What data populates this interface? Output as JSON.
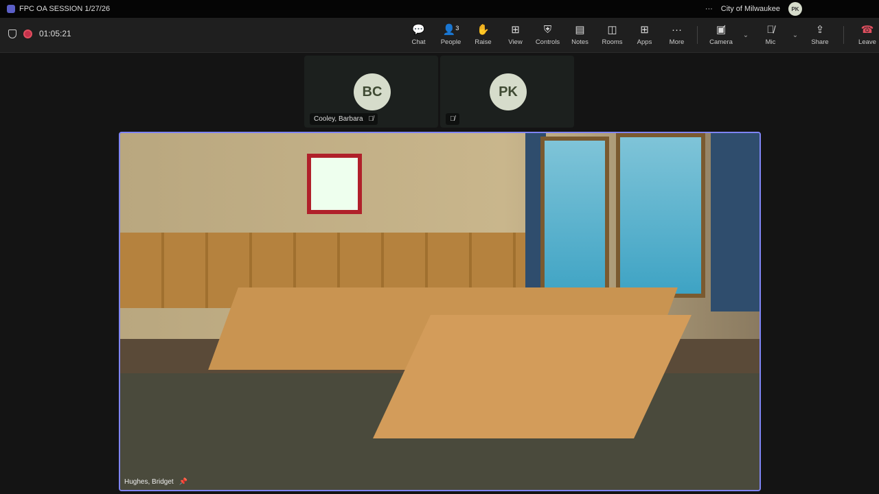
{
  "window": {
    "title": "FPC OA SESSION 1/27/26",
    "org": "City of Milwaukee",
    "user_initials": "PK",
    "more": "···"
  },
  "meeting": {
    "elapsed": "01:05:21"
  },
  "toolbar": [
    {
      "label": "Chat",
      "icon": "💬"
    },
    {
      "label": "People",
      "icon": "👤³"
    },
    {
      "label": "Raise",
      "icon": "✋"
    },
    {
      "label": "View",
      "icon": "⊞"
    },
    {
      "label": "Controls",
      "icon": "⛨"
    },
    {
      "label": "Notes",
      "icon": "▤"
    },
    {
      "label": "Rooms",
      "icon": "◫"
    },
    {
      "label": "Apps",
      "icon": "⊞"
    },
    {
      "label": "More",
      "icon": "···"
    }
  ],
  "media": {
    "camera": "Camera",
    "mic": "Mic",
    "share": "Share",
    "leave": "Leave"
  },
  "participants": [
    {
      "initials": "BC",
      "name": "Cooley, Barbara"
    },
    {
      "initials": "PK",
      "name": ""
    }
  ],
  "stage": {
    "name": "Hughes, Bridget"
  },
  "colors": {
    "accent": "#7f85f5",
    "leave": "#c4314b"
  }
}
